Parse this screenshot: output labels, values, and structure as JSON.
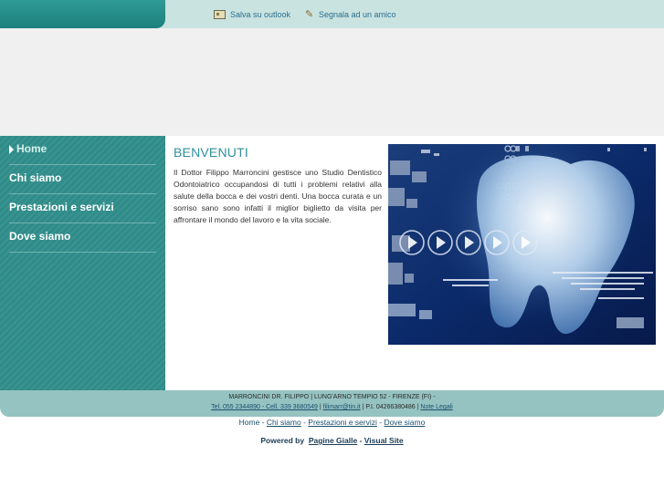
{
  "top_links": {
    "outlook": "Salva su outlook",
    "friend": "Segnala ad un amico"
  },
  "sidebar": {
    "items": [
      {
        "label": "Home",
        "active": true
      },
      {
        "label": "Chi siamo",
        "active": false
      },
      {
        "label": "Prestazioni e servizi",
        "active": false
      },
      {
        "label": "Dove siamo",
        "active": false
      }
    ]
  },
  "main": {
    "title": "BENVENUTI",
    "text": "Il Dottor Filippo Marroncini gestisce uno Studio Dentistico Odontoiatrico occupandosi di tutti i problemi relativi alla salute della bocca e dei vostri denti. Una bocca curata e un sorriso sano sono infatti il miglior biglietto da visita per affrontare il mondo del lavoro e la vita sociale."
  },
  "footer": {
    "line1": "MARRONCINI DR. FILIPPO | LUNG'ARNO TEMPIO 52 - FIRENZE (FI) -",
    "phone": "Tel. 055 2344890 - Cell. 339 3680549",
    "sep1": " | ",
    "email": "filimarr@tin.it",
    "sep2": " | P.I. 04266380486 | ",
    "legal": "Note Legali"
  },
  "bottom_nav": {
    "items": [
      "Home",
      "Chi siamo",
      "Prestazioni e servizi",
      "Dove siamo"
    ],
    "separator": " - "
  },
  "powered": {
    "prefix": "Powered by",
    "link1": "Pagine Gialle",
    "dash": " - ",
    "link2": "Visual Site"
  },
  "colors": {
    "accent": "#2f8c89",
    "title": "#2f8f9b",
    "topbar": "#c9e3e1",
    "footer": "#95c3c1"
  }
}
